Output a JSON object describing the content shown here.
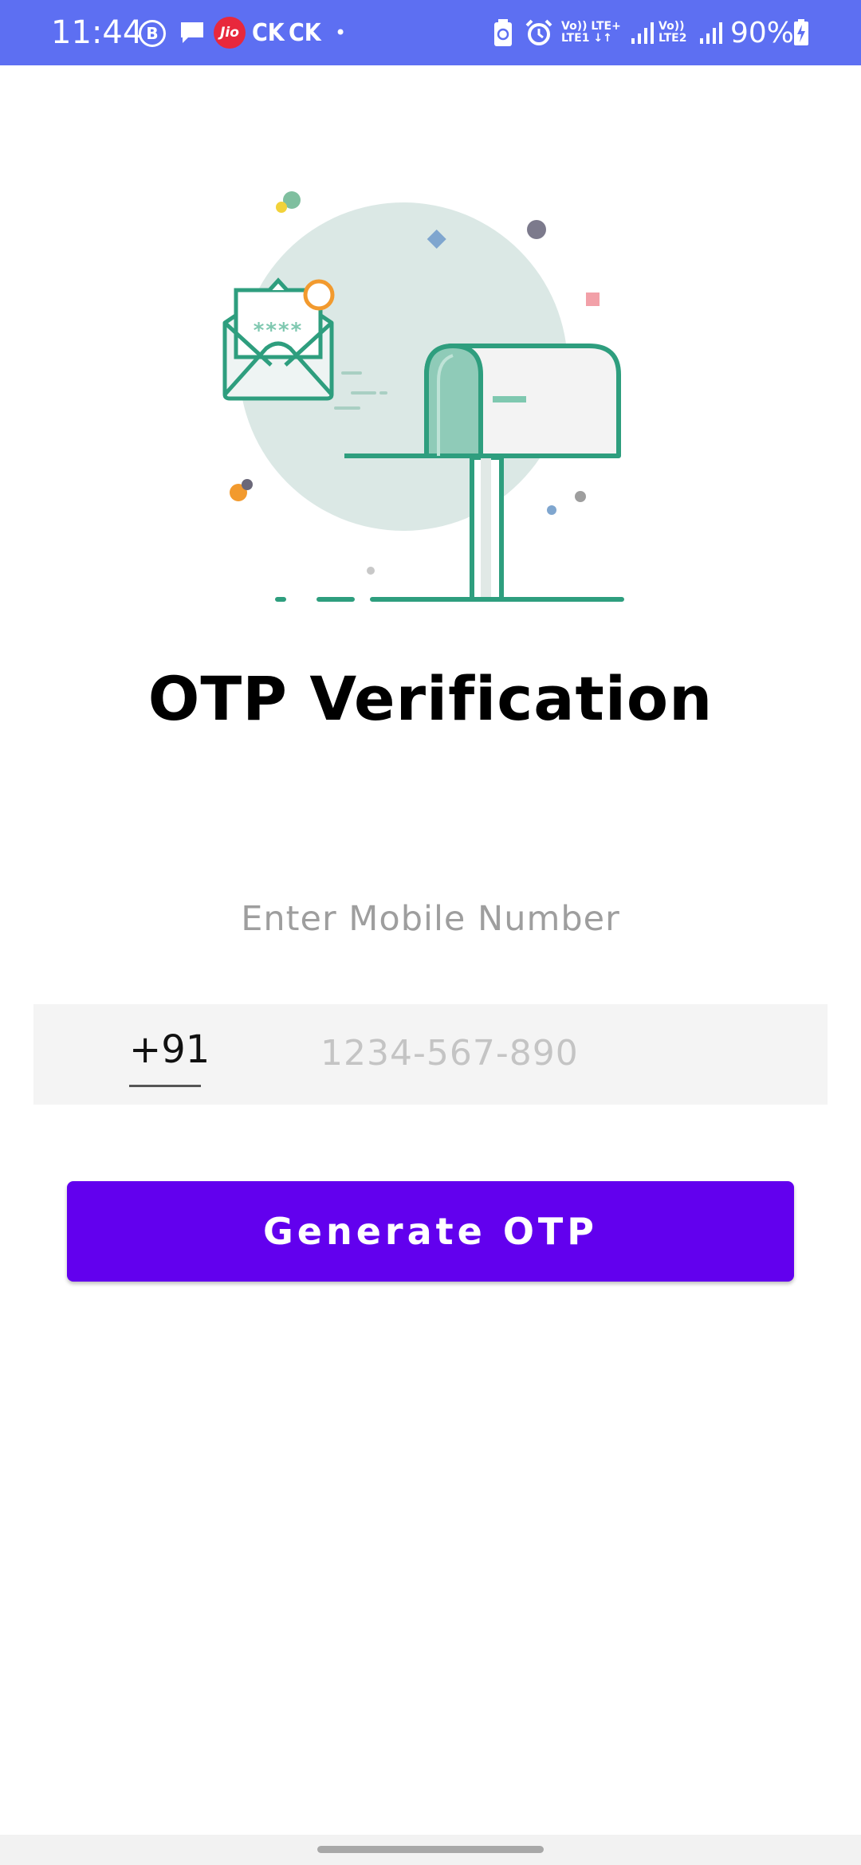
{
  "status_bar": {
    "time": "11:44",
    "b_icon_label": "B",
    "jio_label": "Jio",
    "ck1": "CK",
    "ck2": "CK",
    "dot": "•",
    "lte1_top": "Vo)) LTE+",
    "lte1_bottom": "LTE1 ↓↑",
    "lte2_top": "Vo))",
    "lte2_bottom": "LTE2",
    "battery": "90%",
    "icons": [
      "b-circle-icon",
      "message-icon",
      "jio-icon",
      "battery-saver-icon",
      "alarm-icon",
      "signal-icon",
      "battery-charging-icon"
    ]
  },
  "illustration": {
    "otp_mask": "****",
    "icons": [
      "envelope-icon",
      "mailbox-icon"
    ]
  },
  "main": {
    "title": "OTP Verification",
    "subtitle": "Enter Mobile Number",
    "country_code": "+91",
    "phone_placeholder": "1234-567-890",
    "phone_value": "",
    "button_label": "Generate OTP"
  },
  "colors": {
    "status_bar": "#5d6ff2",
    "button": "#6200ee",
    "input_bg": "#f4f4f4",
    "illustration_green": "#2e9e7e"
  }
}
